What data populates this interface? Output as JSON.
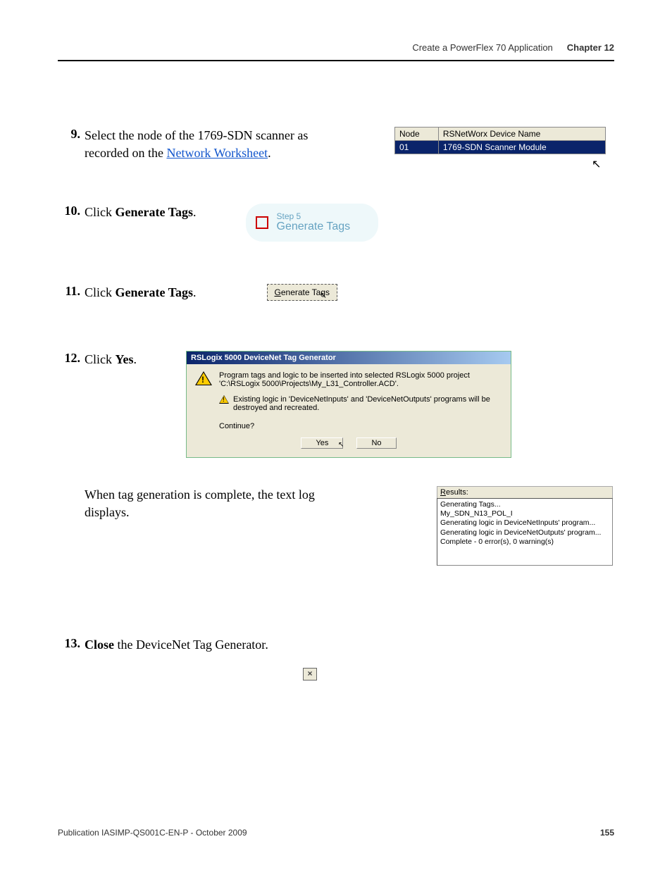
{
  "header": {
    "title": "Create a PowerFlex 70 Application",
    "chapter": "Chapter 12"
  },
  "steps": {
    "s9": {
      "num": "9.",
      "text_prefix": "Select the node of the 1769-SDN scanner as recorded on the ",
      "link": "Network Worksheet",
      "text_suffix": "."
    },
    "s10": {
      "num": "10.",
      "text_prefix": "Click ",
      "bold": "Generate Tags",
      "text_suffix": "."
    },
    "s11": {
      "num": "11.",
      "text_prefix": "Click ",
      "bold": "Generate Tags",
      "text_suffix": "."
    },
    "s12": {
      "num": "12.",
      "text_prefix": "Click ",
      "bold": "Yes",
      "text_suffix": "."
    },
    "post": "When tag generation is complete, the text log displays.",
    "s13": {
      "num": "13.",
      "bold": "Close",
      "text_suffix": " the DeviceNet Tag Generator."
    }
  },
  "node_table": {
    "col1": "Node",
    "col2": "RSNetWorx Device Name",
    "row_node": "01",
    "row_name": "1769-SDN Scanner Module"
  },
  "bubble": {
    "small": "Step 5",
    "big": "Generate Tags"
  },
  "gen_button": {
    "g": "G",
    "rest": "enerate Tags"
  },
  "dialog": {
    "title": "RSLogix 5000 DeviceNet Tag Generator",
    "msg1": "Program tags and logic to be inserted into selected RSLogix 5000 project 'C:\\RSLogix 5000\\Projects\\My_L31_Controller.ACD'.",
    "msg2": "Existing logic in 'DeviceNetInputs' and 'DeviceNetOutputs' programs will be destroyed and recreated.",
    "continue": "Continue?",
    "yes": "Yes",
    "no": "No"
  },
  "results": {
    "label_u": "R",
    "label_rest": "esults:",
    "log": "Generating Tags...\nMy_SDN_N13_POL_I\nGenerating logic in DeviceNetInputs' program...\nGenerating logic in DeviceNetOutputs' program...\nComplete - 0 error(s), 0 warning(s)"
  },
  "close_x": "×",
  "footer": {
    "pub": "Publication IASIMP-QS001C-EN-P - October 2009",
    "page": "155"
  }
}
